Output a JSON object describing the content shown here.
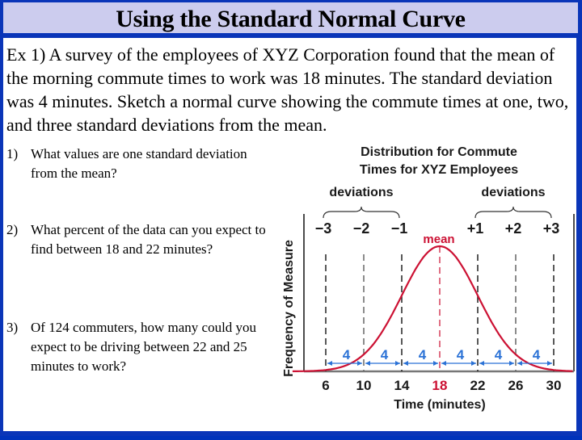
{
  "slide": {
    "title": "Using the Standard Normal Curve",
    "intro": "Ex 1) A survey of the employees of XYZ Corporation found that the mean of the morning commute times to work was 18 minutes. The standard deviation was 4 minutes. Sketch a normal curve showing the commute times at one, two, and three standard deviations from the mean.",
    "questions": [
      {
        "num": "1)",
        "text": "What values are one standard deviation from the mean?"
      },
      {
        "num": "2)",
        "text": "What percent of the data can you expect to find between 18 and 22 minutes?"
      },
      {
        "num": "3)",
        "text": "Of 124 commuters, how many could you expect to be driving between 22 and 25 minutes to work?"
      }
    ]
  },
  "colors": {
    "frame": "#0a35b8",
    "title_bg": "#ccccee",
    "curve": "#cc1133",
    "arrows": "#2b72d6",
    "mean_label": "#cc1133"
  },
  "chart_data": {
    "type": "line",
    "title": "Distribution for Commute Times for XYZ Employees",
    "xlabel": "Time (minutes)",
    "ylabel": "Frequency of Measure",
    "mean": 18,
    "std_dev": 4,
    "xlim": [
      2,
      32
    ],
    "x_ticks": [
      6,
      10,
      14,
      18,
      22,
      26,
      30
    ],
    "x_tick_labels": [
      "6",
      "10",
      "14",
      "18",
      "22",
      "26",
      "30"
    ],
    "highlight_tick": "18",
    "deviation_labels": [
      "−3",
      "−2",
      "−1",
      "+1",
      "+2",
      "+3"
    ],
    "deviation_positions": [
      6,
      10,
      14,
      22,
      26,
      30
    ],
    "group_labels": [
      "deviations",
      "deviations"
    ],
    "mean_label": "mean",
    "interval_width_labels": [
      "4",
      "4",
      "4",
      "4",
      "4",
      "4"
    ],
    "grid": false
  }
}
